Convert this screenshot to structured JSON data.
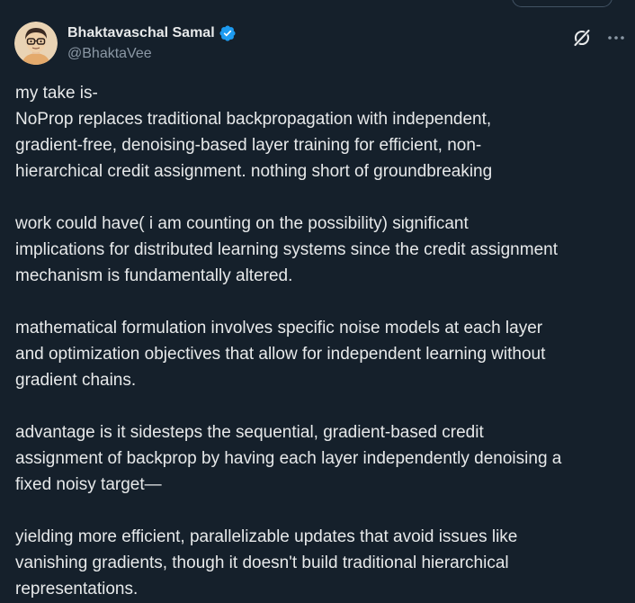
{
  "author": {
    "display_name": "Bhaktavaschal Samal",
    "handle": "@BhaktaVee",
    "verified": true,
    "verified_color": "#1d9bf0"
  },
  "actions": {
    "grok_icon": "grok-icon",
    "more_icon": "more-horizontal-icon"
  },
  "post": {
    "lines": [
      "my take is-",
      "NoProp replaces traditional backpropagation with independent,",
      "gradient-free, denoising-based layer training for efficient, non-",
      "hierarchical credit assignment. nothing short of groundbreaking",
      "",
      "work could have( i am counting on the possibility) significant",
      "implications for distributed learning systems since the credit assignment",
      "mechanism is fundamentally altered.",
      "",
      "mathematical formulation involves specific noise models at each layer",
      "and optimization objectives that allow for independent learning without",
      "gradient chains.",
      "",
      "advantage is it sidesteps the sequential, gradient-based credit",
      "assignment of backprop by having each layer independently denoising a",
      "fixed noisy target—",
      "",
      "yielding more efficient, parallelizable updates that avoid issues like",
      "vanishing gradients, though it doesn't build traditional hierarchical",
      "representations."
    ]
  },
  "colors": {
    "background": "#15202b",
    "text_primary": "#e7e9ea",
    "text_secondary": "#8b98a5"
  }
}
